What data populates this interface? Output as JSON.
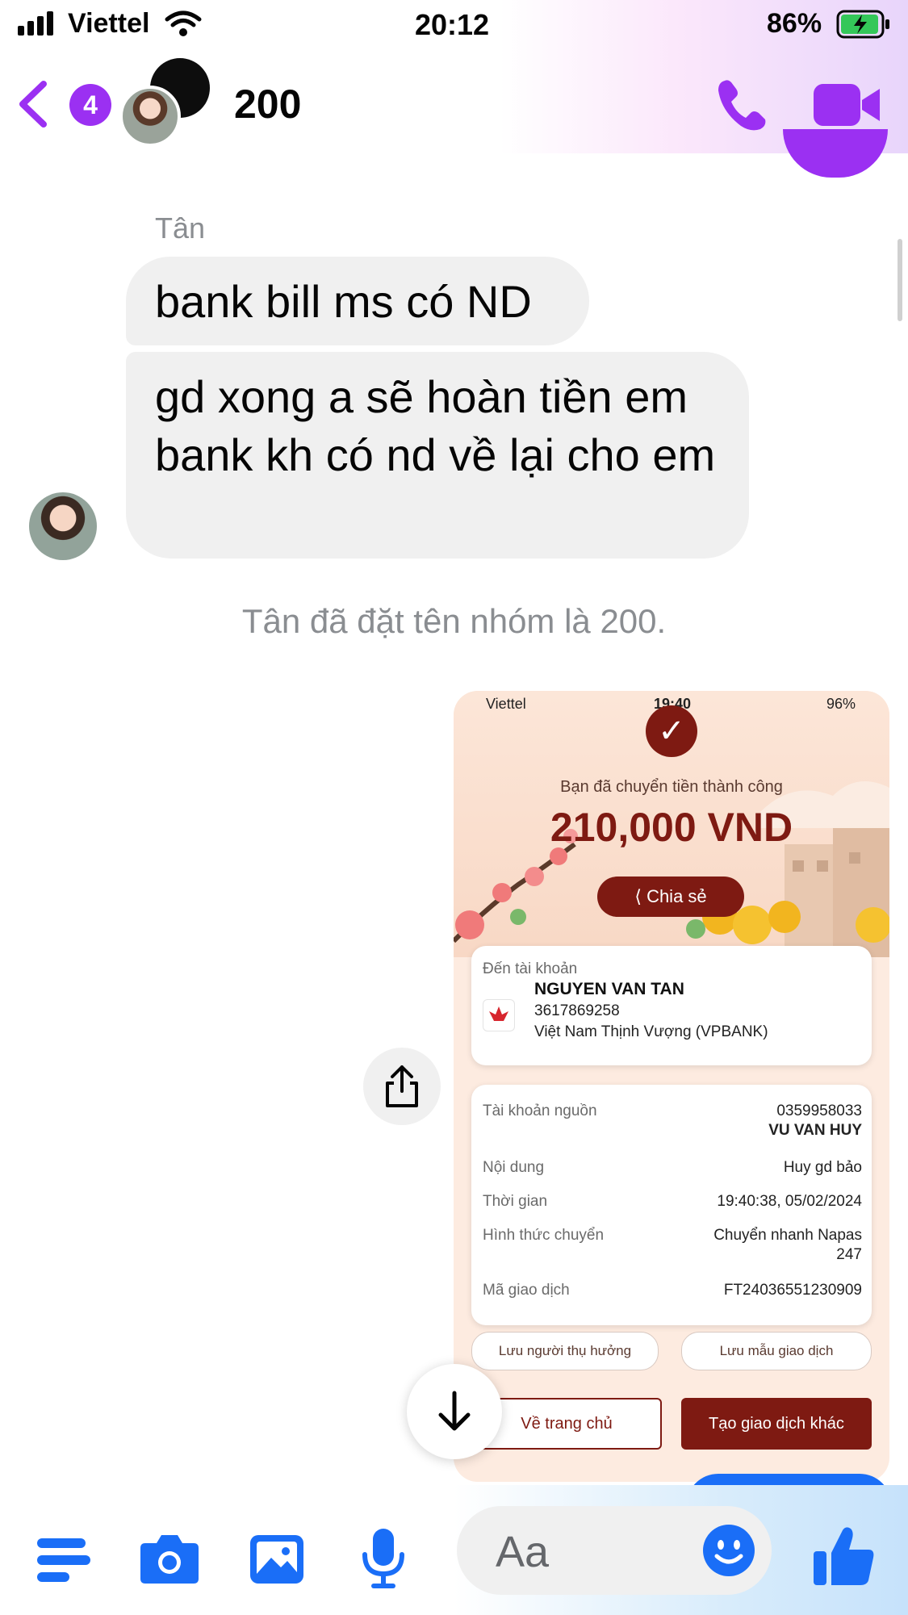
{
  "status_bar": {
    "carrier": "Viettel",
    "time": "20:12",
    "battery": "86%"
  },
  "header": {
    "unread_count": "4",
    "title": "200"
  },
  "conversation": {
    "sender_name": "Tân",
    "messages": [
      "bank bill ms  có ND",
      "gd xong a sẽ hoàn tiền em bank kh có nd về lại cho em"
    ],
    "system_message": "Tân đã đặt tên nhóm là 200."
  },
  "receipt": {
    "status_bar": {
      "carrier": "Viettel",
      "time": "19:40",
      "battery": "96%"
    },
    "success_text": "Bạn đã chuyển tiền thành công",
    "amount": "210,000 VND",
    "share_label": "Chia sẻ",
    "to_label": "Đến tài khoản",
    "to_name": "NGUYEN VAN TAN",
    "to_account": "3617869258",
    "to_bank": "Việt Nam Thịnh Vượng (VPBANK)",
    "details": [
      {
        "label": "Tài khoản nguồn",
        "value": "0359958033",
        "value2": "VU VAN HUY"
      },
      {
        "label": "Nội dung",
        "value": "Huy gd bảo"
      },
      {
        "label": "Thời gian",
        "value": "19:40:38, 05/02/2024"
      },
      {
        "label": "Hình thức chuyển",
        "value": "Chuyển nhanh Napas",
        "value2": "247"
      },
      {
        "label": "Mã giao dịch",
        "value": "FT24036551230909"
      }
    ],
    "save_payee": "Lưu người thụ hưởng",
    "save_template": "Lưu mẫu giao dịch",
    "home": "Về trang chủ",
    "new_transaction": "Tạo giao dịch khác"
  },
  "composer": {
    "placeholder": "Aa"
  },
  "colors": {
    "accent_purple": "#9b30f2",
    "messenger_blue": "#1a6ef7",
    "bank_red": "#7e1a12",
    "bubble_gray": "#f0f0f0"
  },
  "icons": [
    "back-chevron-icon",
    "phone-icon",
    "video-camera-icon",
    "share-icon",
    "arrow-down-icon",
    "menu-icon",
    "camera-icon",
    "image-icon",
    "microphone-icon",
    "emoji-icon",
    "thumbs-up-icon"
  ]
}
